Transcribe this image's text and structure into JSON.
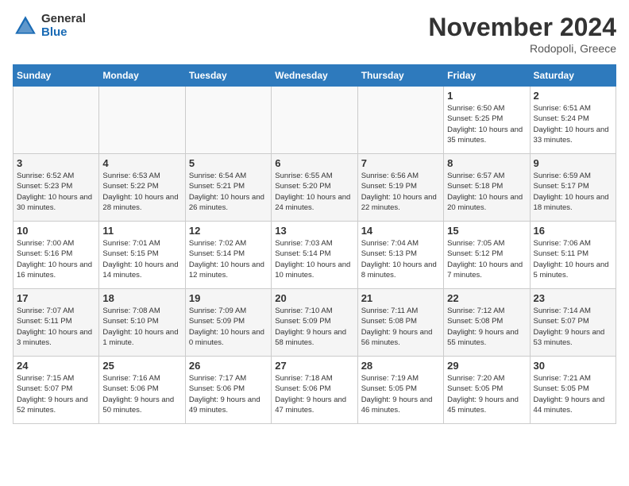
{
  "logo": {
    "general": "General",
    "blue": "Blue"
  },
  "title": "November 2024",
  "location": "Rodopoli, Greece",
  "days_of_week": [
    "Sunday",
    "Monday",
    "Tuesday",
    "Wednesday",
    "Thursday",
    "Friday",
    "Saturday"
  ],
  "weeks": [
    [
      {
        "day": "",
        "info": ""
      },
      {
        "day": "",
        "info": ""
      },
      {
        "day": "",
        "info": ""
      },
      {
        "day": "",
        "info": ""
      },
      {
        "day": "",
        "info": ""
      },
      {
        "day": "1",
        "info": "Sunrise: 6:50 AM\nSunset: 5:25 PM\nDaylight: 10 hours and 35 minutes."
      },
      {
        "day": "2",
        "info": "Sunrise: 6:51 AM\nSunset: 5:24 PM\nDaylight: 10 hours and 33 minutes."
      }
    ],
    [
      {
        "day": "3",
        "info": "Sunrise: 6:52 AM\nSunset: 5:23 PM\nDaylight: 10 hours and 30 minutes."
      },
      {
        "day": "4",
        "info": "Sunrise: 6:53 AM\nSunset: 5:22 PM\nDaylight: 10 hours and 28 minutes."
      },
      {
        "day": "5",
        "info": "Sunrise: 6:54 AM\nSunset: 5:21 PM\nDaylight: 10 hours and 26 minutes."
      },
      {
        "day": "6",
        "info": "Sunrise: 6:55 AM\nSunset: 5:20 PM\nDaylight: 10 hours and 24 minutes."
      },
      {
        "day": "7",
        "info": "Sunrise: 6:56 AM\nSunset: 5:19 PM\nDaylight: 10 hours and 22 minutes."
      },
      {
        "day": "8",
        "info": "Sunrise: 6:57 AM\nSunset: 5:18 PM\nDaylight: 10 hours and 20 minutes."
      },
      {
        "day": "9",
        "info": "Sunrise: 6:59 AM\nSunset: 5:17 PM\nDaylight: 10 hours and 18 minutes."
      }
    ],
    [
      {
        "day": "10",
        "info": "Sunrise: 7:00 AM\nSunset: 5:16 PM\nDaylight: 10 hours and 16 minutes."
      },
      {
        "day": "11",
        "info": "Sunrise: 7:01 AM\nSunset: 5:15 PM\nDaylight: 10 hours and 14 minutes."
      },
      {
        "day": "12",
        "info": "Sunrise: 7:02 AM\nSunset: 5:14 PM\nDaylight: 10 hours and 12 minutes."
      },
      {
        "day": "13",
        "info": "Sunrise: 7:03 AM\nSunset: 5:14 PM\nDaylight: 10 hours and 10 minutes."
      },
      {
        "day": "14",
        "info": "Sunrise: 7:04 AM\nSunset: 5:13 PM\nDaylight: 10 hours and 8 minutes."
      },
      {
        "day": "15",
        "info": "Sunrise: 7:05 AM\nSunset: 5:12 PM\nDaylight: 10 hours and 7 minutes."
      },
      {
        "day": "16",
        "info": "Sunrise: 7:06 AM\nSunset: 5:11 PM\nDaylight: 10 hours and 5 minutes."
      }
    ],
    [
      {
        "day": "17",
        "info": "Sunrise: 7:07 AM\nSunset: 5:11 PM\nDaylight: 10 hours and 3 minutes."
      },
      {
        "day": "18",
        "info": "Sunrise: 7:08 AM\nSunset: 5:10 PM\nDaylight: 10 hours and 1 minute."
      },
      {
        "day": "19",
        "info": "Sunrise: 7:09 AM\nSunset: 5:09 PM\nDaylight: 10 hours and 0 minutes."
      },
      {
        "day": "20",
        "info": "Sunrise: 7:10 AM\nSunset: 5:09 PM\nDaylight: 9 hours and 58 minutes."
      },
      {
        "day": "21",
        "info": "Sunrise: 7:11 AM\nSunset: 5:08 PM\nDaylight: 9 hours and 56 minutes."
      },
      {
        "day": "22",
        "info": "Sunrise: 7:12 AM\nSunset: 5:08 PM\nDaylight: 9 hours and 55 minutes."
      },
      {
        "day": "23",
        "info": "Sunrise: 7:14 AM\nSunset: 5:07 PM\nDaylight: 9 hours and 53 minutes."
      }
    ],
    [
      {
        "day": "24",
        "info": "Sunrise: 7:15 AM\nSunset: 5:07 PM\nDaylight: 9 hours and 52 minutes."
      },
      {
        "day": "25",
        "info": "Sunrise: 7:16 AM\nSunset: 5:06 PM\nDaylight: 9 hours and 50 minutes."
      },
      {
        "day": "26",
        "info": "Sunrise: 7:17 AM\nSunset: 5:06 PM\nDaylight: 9 hours and 49 minutes."
      },
      {
        "day": "27",
        "info": "Sunrise: 7:18 AM\nSunset: 5:06 PM\nDaylight: 9 hours and 47 minutes."
      },
      {
        "day": "28",
        "info": "Sunrise: 7:19 AM\nSunset: 5:05 PM\nDaylight: 9 hours and 46 minutes."
      },
      {
        "day": "29",
        "info": "Sunrise: 7:20 AM\nSunset: 5:05 PM\nDaylight: 9 hours and 45 minutes."
      },
      {
        "day": "30",
        "info": "Sunrise: 7:21 AM\nSunset: 5:05 PM\nDaylight: 9 hours and 44 minutes."
      }
    ]
  ]
}
